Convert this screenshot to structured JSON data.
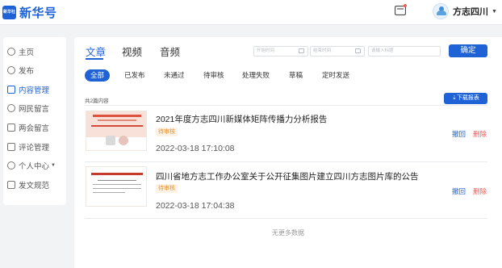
{
  "header": {
    "logo_badge": "新华社",
    "logo_text": "新华号",
    "user_name": "方志四川",
    "user_caret": "▼"
  },
  "sidebar": {
    "items": [
      {
        "label": "主页",
        "icon": "home-icon"
      },
      {
        "label": "发布",
        "icon": "publish-icon"
      },
      {
        "label": "内容管理",
        "icon": "content-icon",
        "active": true
      },
      {
        "label": "网民留言",
        "icon": "message-icon"
      },
      {
        "label": "两会留言",
        "icon": "congress-message-icon"
      },
      {
        "label": "评论管理",
        "icon": "comment-icon"
      },
      {
        "label": "个人中心",
        "icon": "user-icon",
        "caret": "▼"
      },
      {
        "label": "发文规范",
        "icon": "rules-icon"
      }
    ]
  },
  "tabs": [
    {
      "label": "文章",
      "active": true
    },
    {
      "label": "视频"
    },
    {
      "label": "音频"
    }
  ],
  "filters": {
    "start_date_placeholder": "开始时间",
    "end_date_placeholder": "结束时间",
    "title_placeholder": "请输入标题",
    "confirm_label": "确定"
  },
  "status_chips": [
    {
      "label": "全部",
      "active": true
    },
    {
      "label": "已发布"
    },
    {
      "label": "未通过"
    },
    {
      "label": "待审核"
    },
    {
      "label": "处理失败"
    },
    {
      "label": "草稿"
    },
    {
      "label": "定时发送"
    }
  ],
  "list": {
    "total_text": "共2篇内容",
    "download_label": "⇣下载报表",
    "articles": [
      {
        "title": "2021年度方志四川新媒体矩阵传播力分析报告",
        "status": "待审核",
        "time": "2022-03-18 17:10:08",
        "withdraw_label": "撤回",
        "delete_label": "删除"
      },
      {
        "title": "四川省地方志工作办公室关于公开征集图片建立四川方志图片库的公告",
        "status": "待审核",
        "time": "2022-03-18 17:04:38",
        "withdraw_label": "撤回",
        "delete_label": "删除"
      }
    ],
    "no_more_text": "无更多数据"
  },
  "colors": {
    "accent": "#1e62d6",
    "pending": "#e8912c",
    "danger": "#ef5a5a"
  }
}
